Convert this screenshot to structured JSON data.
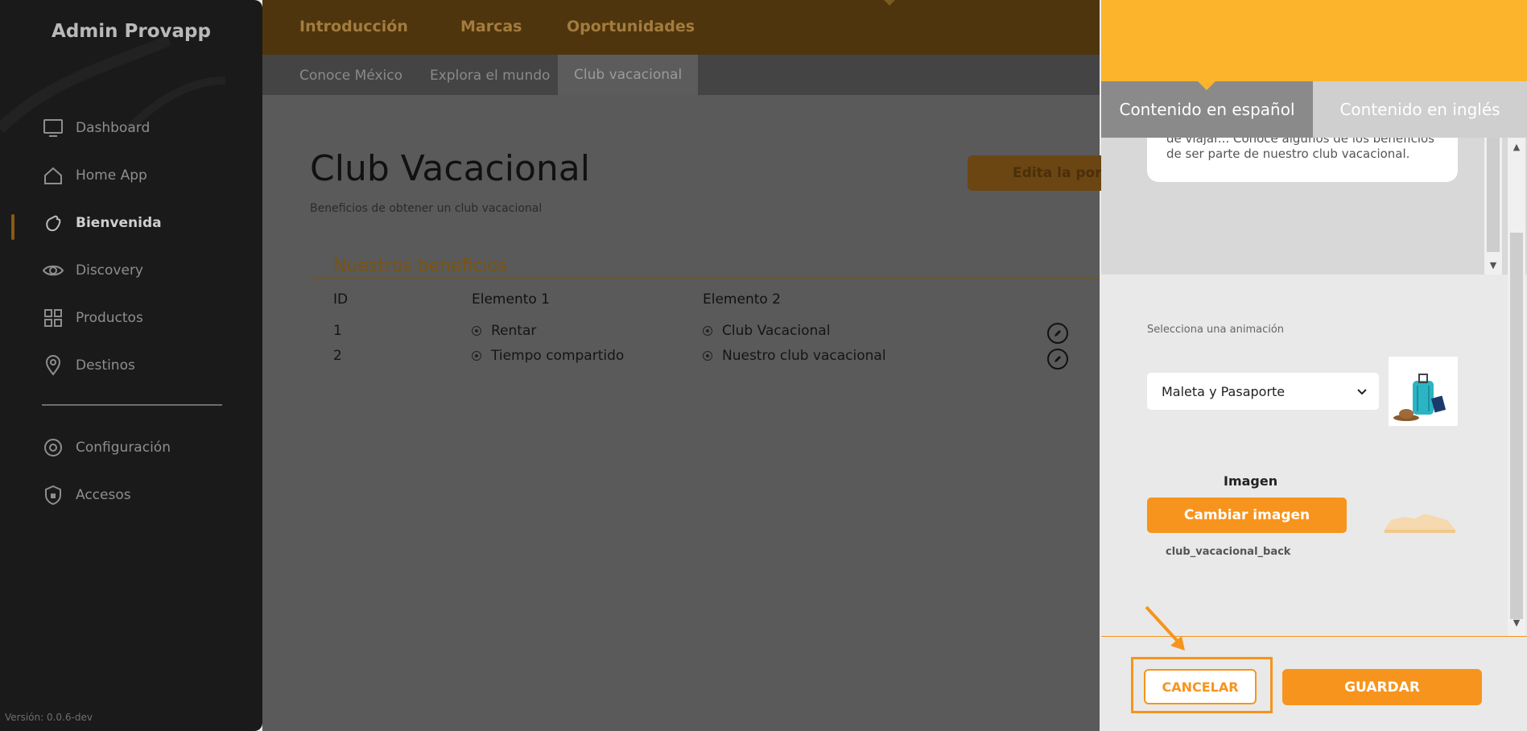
{
  "app": {
    "title": "Admin Provapp",
    "version": "Versión: 0.0.6-dev"
  },
  "sidebar": {
    "items": [
      {
        "label": "Dashboard",
        "icon": "monitor-icon"
      },
      {
        "label": "Home App",
        "icon": "home-icon"
      },
      {
        "label": "Bienvenida",
        "icon": "waving-hand-icon",
        "active": true
      },
      {
        "label": "Discovery",
        "icon": "eye-icon"
      },
      {
        "label": "Productos",
        "icon": "grid-icon"
      },
      {
        "label": "Destinos",
        "icon": "location-pin-icon"
      },
      {
        "label": "Configuración",
        "icon": "gear-icon"
      },
      {
        "label": "Accesos",
        "icon": "shield-icon"
      }
    ]
  },
  "topnav": {
    "tabs": [
      "Introducción",
      "Marcas",
      "Oportunidades"
    ]
  },
  "subnav": {
    "tabs": [
      "Conoce México",
      "Explora el mundo",
      "Club vacacional"
    ],
    "active": "Club vacacional"
  },
  "page": {
    "title": "Club Vacacional",
    "subtitle": "Beneficios de obtener un club vacacional",
    "edit_button": "Edita la portada"
  },
  "benefits": {
    "title": "Nuestros beneficios",
    "columns": [
      "ID",
      "Elemento 1",
      "Elemento 2"
    ],
    "rows": [
      {
        "id": "1",
        "el1": "Rentar",
        "el2": "Club Vacacional"
      },
      {
        "id": "2",
        "el1": "Tiempo compartido",
        "el2": "Nuestro club vacacional"
      }
    ]
  },
  "drawer": {
    "tabs": {
      "spanish": "Contenido en español",
      "english": "Contenido en inglés"
    },
    "editor_line1": "de viajar... Conoce algunos de los beneficios",
    "editor_line2": "de ser parte de nuestro club vacacional.",
    "animation_label": "Selecciona una animación",
    "animation_selected": "Maleta y Pasaporte",
    "image_label": "Imagen",
    "change_image_button": "Cambiar imagen",
    "file_name": "club_vacacional_back",
    "cancel_button": "CANCELAR",
    "save_button": "GUARDAR"
  },
  "colors": {
    "accent": "#f7941d",
    "header": "#fbb42b",
    "sidebar": "#1a1a1a"
  }
}
